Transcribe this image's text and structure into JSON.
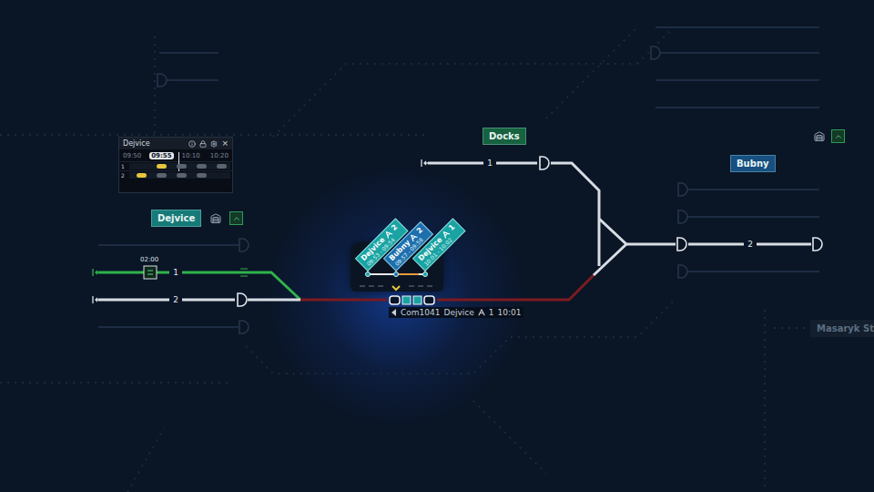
{
  "timetable": {
    "title": "Dejvice",
    "close": "×",
    "times": [
      {
        "label": "09:50",
        "selected": false
      },
      {
        "label": "09:55",
        "selected": true
      },
      {
        "label": "10:10",
        "selected": false
      },
      {
        "label": "10:20",
        "selected": false
      }
    ],
    "rows": [
      {
        "track": "1",
        "entries": [
          {
            "color": "#e8c53a"
          },
          {
            "color": "#5b6470"
          },
          {
            "color": "#5b6470"
          },
          {
            "color": "#5b6470"
          }
        ]
      },
      {
        "track": "2",
        "entries": [
          {
            "color": "#e8c53a"
          },
          {
            "color": "#5b6470"
          },
          {
            "color": "#5b6470"
          },
          {
            "color": "#5b6470"
          }
        ]
      }
    ]
  },
  "stations": [
    {
      "name": "Dejvice",
      "color": "#167a78",
      "dimmed": false,
      "controls": true
    },
    {
      "name": "Docks",
      "color": "#17623f",
      "dimmed": false,
      "controls": false
    },
    {
      "name": "Bubny",
      "color": "#174f80",
      "dimmed": false,
      "controls": false
    },
    {
      "name": "Masaryk St",
      "color": "#131f2e",
      "dimmed": true,
      "controls": false
    }
  ],
  "track_numbers": [
    "1",
    "2",
    "1",
    "2"
  ],
  "timer": "02:00",
  "routes": [
    {
      "name": "dejvice-1",
      "state": "set"
    },
    {
      "name": "dejvice-2",
      "state": "free"
    },
    {
      "name": "main-line",
      "state": "occupied"
    },
    {
      "name": "docks-line",
      "state": "free"
    },
    {
      "name": "bubny-line",
      "state": "free"
    }
  ],
  "train_tags": [
    {
      "station": "Dejvice",
      "platform": "2",
      "times": "09:53 - 09:54",
      "color": "#1aa3a3"
    },
    {
      "station": "Bubny",
      "platform": "2",
      "times": "09:57 - 09:58",
      "color": "#1e6fae"
    },
    {
      "station": "Dejvice",
      "platform": "1",
      "times": "10:01 - 10:02",
      "color": "#1aa3a3"
    }
  ],
  "train": {
    "name": "Com1041",
    "destination": "Dejvice",
    "platform": "1",
    "time": "10:01"
  }
}
